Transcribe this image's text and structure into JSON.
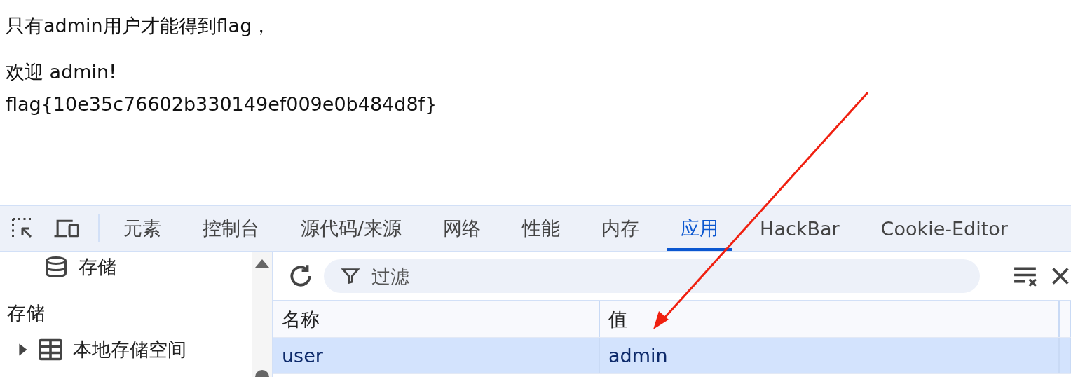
{
  "page": {
    "lines": [
      "只有admin用户才能得到flag，",
      "欢迎 admin!",
      "flag{10e35c76602b330149ef009e0b484d8f}"
    ]
  },
  "devtools": {
    "tabs": [
      {
        "label": "元素",
        "selected": false
      },
      {
        "label": "控制台",
        "selected": false
      },
      {
        "label": "源代码/来源",
        "selected": false
      },
      {
        "label": "网络",
        "selected": false
      },
      {
        "label": "性能",
        "selected": false
      },
      {
        "label": "内存",
        "selected": false
      },
      {
        "label": "应用",
        "selected": true
      },
      {
        "label": "HackBar",
        "selected": false
      },
      {
        "label": "Cookie-Editor",
        "selected": false
      }
    ],
    "sidebar": {
      "top_item": "存储",
      "section": "存储",
      "items": [
        {
          "label": "本地存储空间",
          "expanded": false
        }
      ]
    },
    "filter": {
      "placeholder": "过滤"
    },
    "table": {
      "columns": [
        "名称",
        "值"
      ],
      "rows": [
        {
          "cells": [
            "user",
            "admin"
          ],
          "selected": true
        }
      ]
    }
  }
}
